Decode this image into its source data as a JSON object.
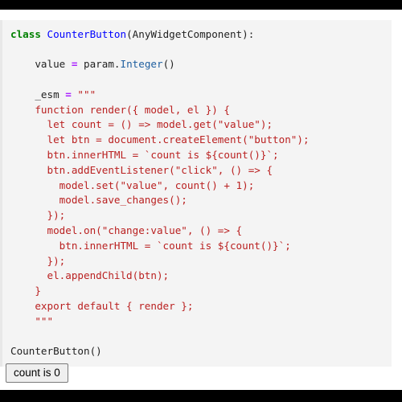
{
  "theme": {
    "page_background": "#ffffff",
    "band_color": "#000000",
    "code_background": "#f4f4f4",
    "code_gutter": "#e8e8e8",
    "keyword_color": "#008000",
    "class_color": "#0000ff",
    "operator_color": "#aa22ff",
    "builtin_color": "#2060a0",
    "string_color": "#ba2121",
    "text_color": "#222222",
    "button_background": "#efefef",
    "button_border": "#7a7a7a"
  },
  "cell": {
    "name": "code-cell",
    "language": "python",
    "code_lines": [
      [
        {
          "t": "class ",
          "c": "tok-kw"
        },
        {
          "t": "CounterButton",
          "c": "tok-class"
        },
        {
          "t": "(AnyWidgetComponent):",
          "c": "tok-plain"
        }
      ],
      [],
      [
        {
          "t": "    value ",
          "c": "tok-plain"
        },
        {
          "t": "=",
          "c": "tok-op"
        },
        {
          "t": " param.",
          "c": "tok-plain"
        },
        {
          "t": "Integer",
          "c": "tok-builtin"
        },
        {
          "t": "()",
          "c": "tok-plain"
        }
      ],
      [],
      [
        {
          "t": "    _esm ",
          "c": "tok-plain"
        },
        {
          "t": "=",
          "c": "tok-op"
        },
        {
          "t": " \"\"\"",
          "c": "tok-str"
        }
      ],
      [
        {
          "t": "    function render({ model, el }) {",
          "c": "tok-str"
        }
      ],
      [
        {
          "t": "      let count = () => model.get(\"value\");",
          "c": "tok-str"
        }
      ],
      [
        {
          "t": "      let btn = document.createElement(\"button\");",
          "c": "tok-str"
        }
      ],
      [
        {
          "t": "      btn.innerHTML = `count is ${count()}`;",
          "c": "tok-str"
        }
      ],
      [
        {
          "t": "      btn.addEventListener(\"click\", () => {",
          "c": "tok-str"
        }
      ],
      [
        {
          "t": "        model.set(\"value\", count() + 1);",
          "c": "tok-str"
        }
      ],
      [
        {
          "t": "        model.save_changes();",
          "c": "tok-str"
        }
      ],
      [
        {
          "t": "      });",
          "c": "tok-str"
        }
      ],
      [
        {
          "t": "      model.on(\"change:value\", () => {",
          "c": "tok-str"
        }
      ],
      [
        {
          "t": "        btn.innerHTML = `count is ${count()}`;",
          "c": "tok-str"
        }
      ],
      [
        {
          "t": "      });",
          "c": "tok-str"
        }
      ],
      [
        {
          "t": "      el.appendChild(btn);",
          "c": "tok-str"
        }
      ],
      [
        {
          "t": "    }",
          "c": "tok-str"
        }
      ],
      [
        {
          "t": "    export default { render };",
          "c": "tok-str"
        }
      ],
      [
        {
          "t": "    \"\"\"",
          "c": "tok-str"
        }
      ],
      [],
      [
        {
          "t": "CounterButton()",
          "c": "tok-plain"
        }
      ]
    ],
    "plain_source": "class CounterButton(AnyWidgetComponent):\n\n    value = param.Integer()\n\n    _esm = \"\"\"\n    function render({ model, el }) {\n      let count = () => model.get(\"value\");\n      let btn = document.createElement(\"button\");\n      btn.innerHTML = `count is ${count()}`;\n      btn.addEventListener(\"click\", () => {\n        model.set(\"value\", count() + 1);\n        model.save_changes();\n      });\n      model.on(\"change:value\", () => {\n        btn.innerHTML = `count is ${count()}`;\n      });\n      el.appendChild(btn);\n    }\n    export default { render };\n    \"\"\"\n\nCounterButton()"
  },
  "output": {
    "name": "cell-output",
    "widget_button_label": "count is 0",
    "count_value": "0"
  }
}
